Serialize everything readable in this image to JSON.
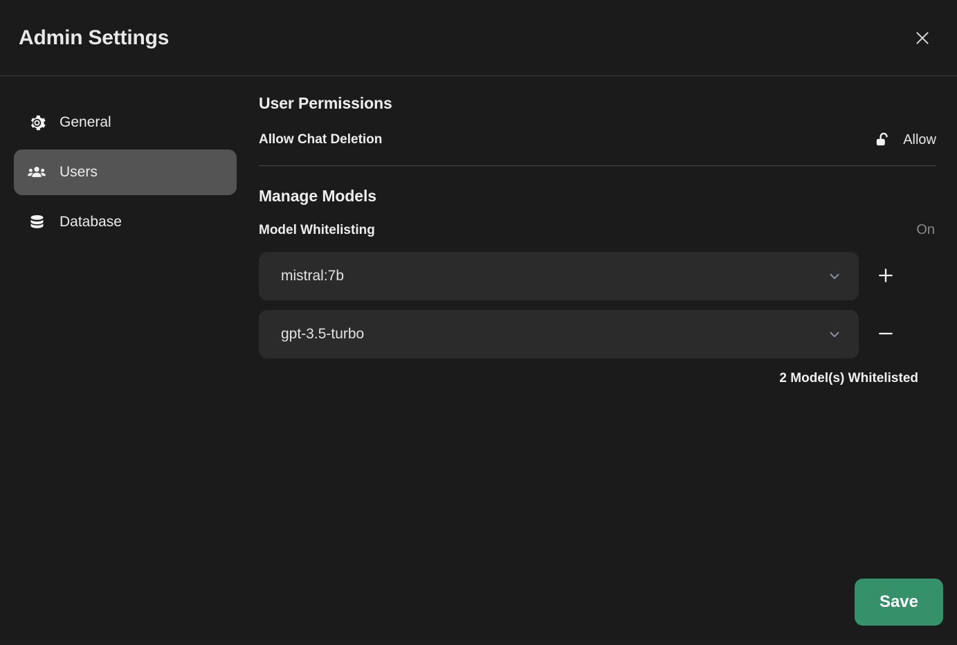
{
  "header": {
    "title": "Admin Settings",
    "close_icon": "close-icon"
  },
  "sidebar": {
    "items": [
      {
        "label": "General",
        "icon": "gear-icon",
        "selected": false
      },
      {
        "label": "Users",
        "icon": "users-icon",
        "selected": true
      },
      {
        "label": "Database",
        "icon": "database-icon",
        "selected": false
      }
    ]
  },
  "content": {
    "user_permissions": {
      "title": "User Permissions",
      "allow_chat_deletion": {
        "label": "Allow Chat Deletion",
        "state": "Allow",
        "icon": "unlock-icon"
      }
    },
    "manage_models": {
      "title": "Manage Models",
      "whitelisting": {
        "label": "Model Whitelisting",
        "state": "On"
      },
      "models": [
        {
          "value": "mistral:7b",
          "action_icon": "plus-icon",
          "action_label": "+"
        },
        {
          "value": "gpt-3.5-turbo",
          "action_icon": "minus-icon",
          "action_label": "−"
        }
      ],
      "count_text": "2 Model(s) Whitelisted"
    }
  },
  "footer": {
    "save_label": "Save"
  },
  "colors": {
    "background": "#1b1b1b",
    "selected_item": "#545454",
    "field": "#2b2b2b",
    "accent_save": "#34916a",
    "muted_text": "#8a8a8a",
    "divider": "#4b4b4b"
  }
}
